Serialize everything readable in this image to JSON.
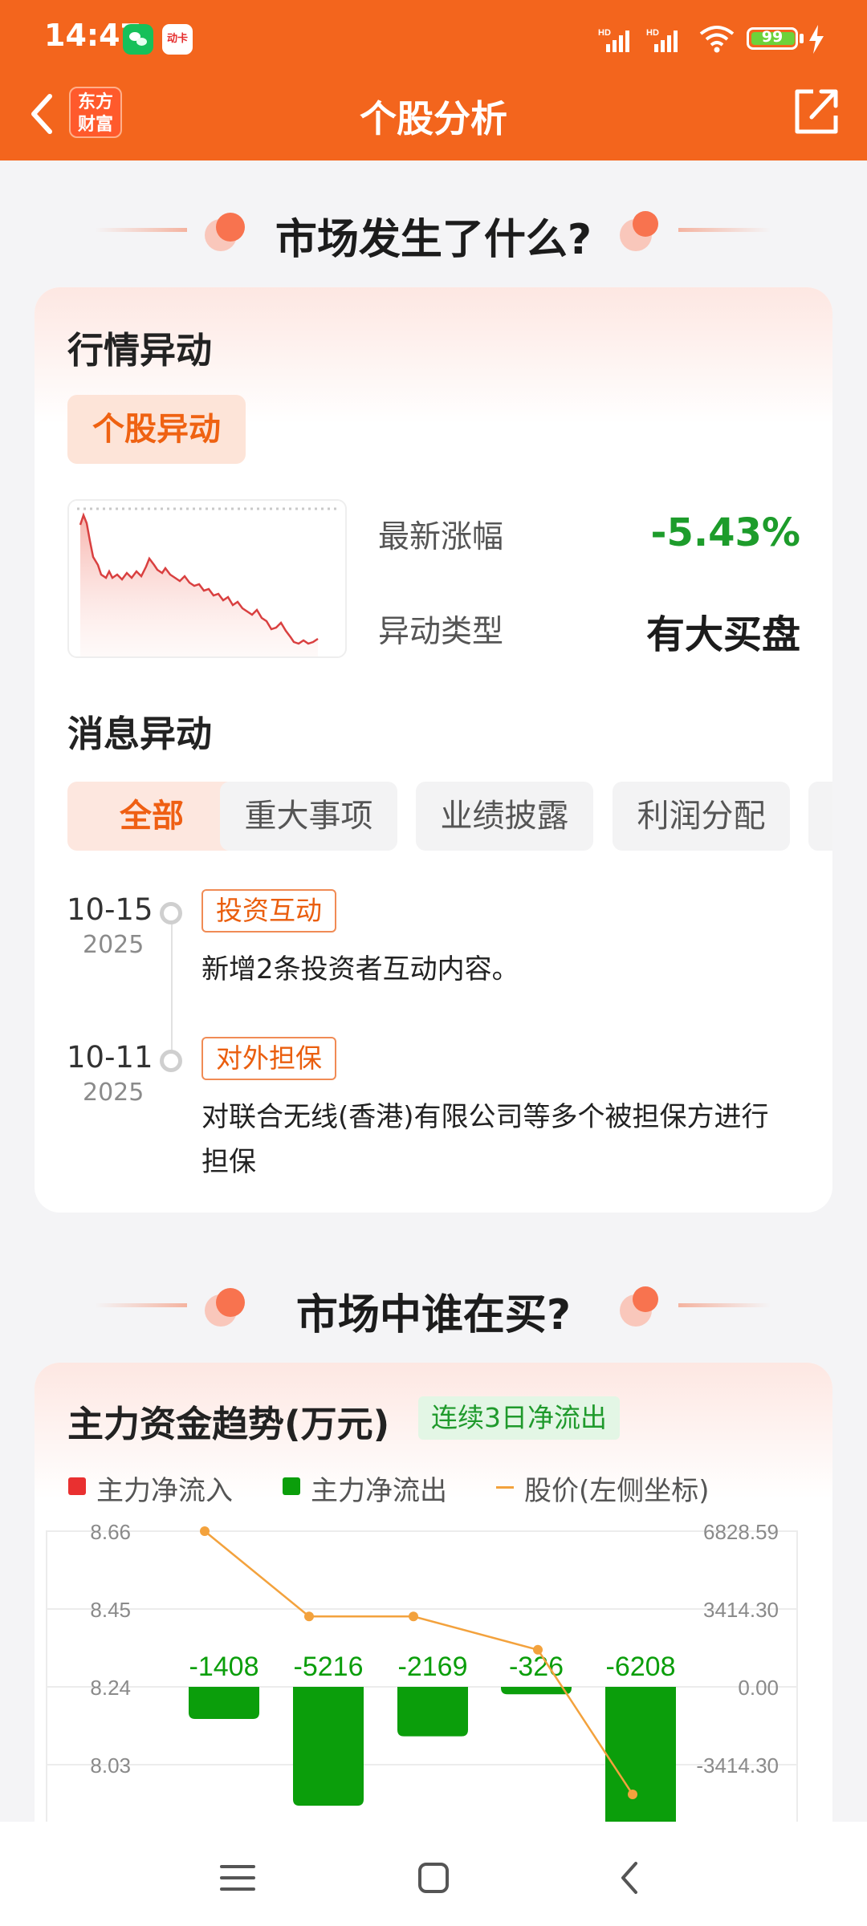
{
  "status_bar": {
    "time": "14:47",
    "mini_app_label": "动卡",
    "signal_1_label": "HD",
    "signal_2_label": "HD",
    "battery_level": "99",
    "icons": [
      "wechat-icon",
      "app-notification-icon",
      "signal-icon",
      "wifi-icon",
      "battery-icon",
      "charging-icon"
    ]
  },
  "nav": {
    "title": "个股分析",
    "logo_text": "东方财富"
  },
  "section1": {
    "title": "市场发生了什么?"
  },
  "market_card": {
    "heading": "行情异动",
    "tag": "个股异动",
    "latest_change_label": "最新涨幅",
    "latest_change_value": "-5.43%",
    "anomaly_type_label": "异动类型",
    "anomaly_type_value": "有大买盘",
    "news_heading": "消息异动",
    "filters": [
      "全部",
      "重大事项",
      "业绩披露",
      "利润分配"
    ],
    "timeline": [
      {
        "date": "10-15",
        "year": "2025",
        "tag": "投资互动",
        "text": "新增2条投资者互动内容。"
      },
      {
        "date": "10-11",
        "year": "2025",
        "tag": "对外担保",
        "text": "对联合无线(香港)有限公司等多个被担保方进行担保"
      }
    ]
  },
  "section2": {
    "title": "市场中谁在买?"
  },
  "flow_card": {
    "heading": "主力资金趋势(万元)",
    "badge": "连续3日净流出",
    "legend": [
      "主力净流入",
      "主力净流出",
      "股价(左侧坐标)"
    ]
  },
  "colors": {
    "accent": "#f3651d",
    "inflow": "#e93030",
    "outflow": "#0b9e0b",
    "price_line": "#f3a23d",
    "down_green": "#1d9c2b"
  },
  "chart_data": {
    "type": "bar",
    "title": "主力资金趋势(万元)",
    "series": [
      {
        "name": "主力净流入",
        "values": [
          0,
          0,
          0,
          0,
          0
        ]
      },
      {
        "name": "主力净流出",
        "values": [
          -1408,
          -5216,
          -2169,
          -326,
          -6208
        ]
      },
      {
        "name": "股价(左侧坐标)",
        "values": [
          8.66,
          8.43,
          8.43,
          8.34,
          7.95
        ]
      }
    ],
    "bar_labels": [
      "-1408",
      "-5216",
      "-2169",
      "-326",
      "-6208"
    ],
    "left_axis_ticks": [
      "8.66",
      "8.45",
      "8.24",
      "8.03"
    ],
    "right_axis_ticks": [
      "6828.59",
      "3414.30",
      "0.00",
      "-3414.30"
    ],
    "left_axis_range": [
      7.82,
      8.66
    ],
    "right_axis_range": [
      -6828.59,
      6828.59
    ],
    "grid": true,
    "legend_position": "top"
  },
  "bottom_nav": {
    "icons": [
      "menu-icon",
      "home-icon",
      "back-icon"
    ]
  }
}
